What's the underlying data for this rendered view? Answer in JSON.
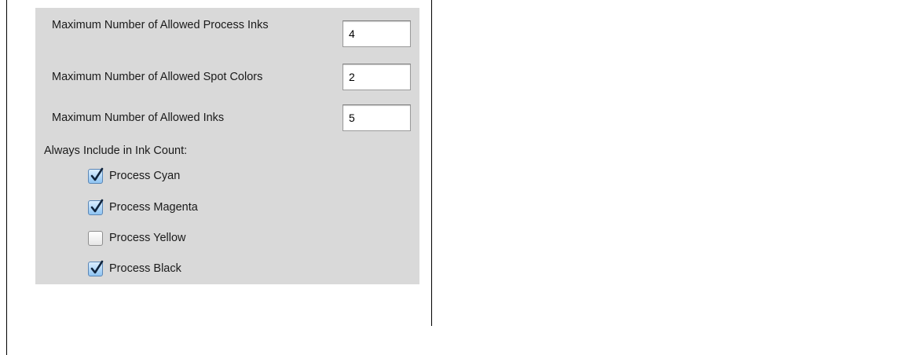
{
  "fields": [
    {
      "label": "Maximum Number of Allowed Process Inks",
      "value": "4"
    },
    {
      "label": "Maximum Number of Allowed Spot Colors",
      "value": "2"
    },
    {
      "label": "Maximum Number of Allowed Inks",
      "value": "5"
    }
  ],
  "ink_count": {
    "label": "Always Include in Ink Count:",
    "options": [
      {
        "label": "Process Cyan",
        "checked": true
      },
      {
        "label": "Process Magenta",
        "checked": true
      },
      {
        "label": "Process Yellow",
        "checked": false
      },
      {
        "label": "Process Black",
        "checked": true
      }
    ]
  },
  "colors": {
    "panel_bg": "#d9d9d9",
    "check_accent": "#8fc4f2"
  },
  "icons": {
    "checkmark": "checkmark-icon"
  }
}
